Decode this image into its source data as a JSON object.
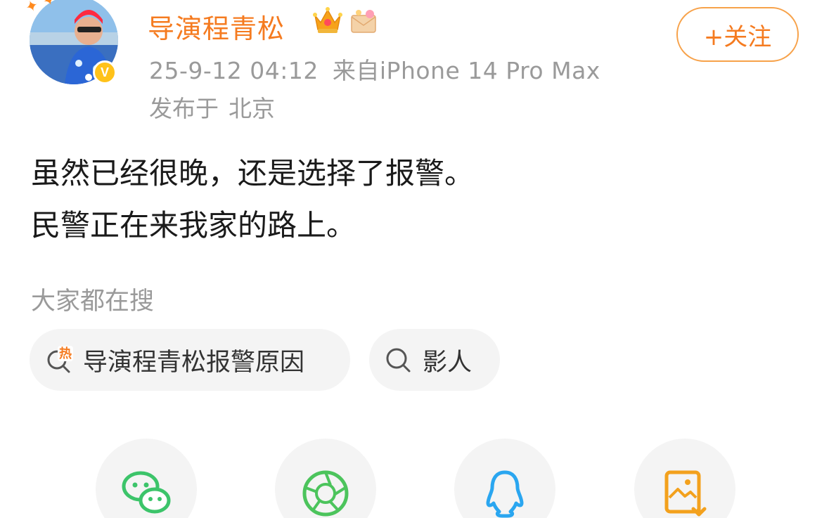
{
  "post": {
    "username": "导演程青松",
    "follow_label": "+关注",
    "timestamp": "25-9-12 04:12",
    "source": "来自iPhone 14 Pro Max",
    "location_prefix": "发布于",
    "location": "北京",
    "text_lines": [
      "虽然已经很晚，还是选择了报警。",
      "民警正在来我家的路上。"
    ],
    "badges": [
      "crown-icon",
      "envelope-icon"
    ],
    "verified": "V"
  },
  "trending": {
    "label": "大家都在搜",
    "items": [
      {
        "icon": "hot-search-icon",
        "text": "导演程青松报警原因"
      },
      {
        "icon": "search-icon",
        "text": "影人"
      }
    ]
  },
  "share": {
    "targets": [
      {
        "icon": "wechat-icon",
        "color": "#3cc46a"
      },
      {
        "icon": "moments-icon",
        "color": "#4cc45c"
      },
      {
        "icon": "qq-icon",
        "color": "#2aa6f0"
      },
      {
        "icon": "save-image-icon",
        "color": "#f3a11d"
      }
    ]
  },
  "colors": {
    "accent": "#f57b20",
    "meta_text": "#9a9a9a",
    "chip_bg": "#f4f4f4"
  }
}
